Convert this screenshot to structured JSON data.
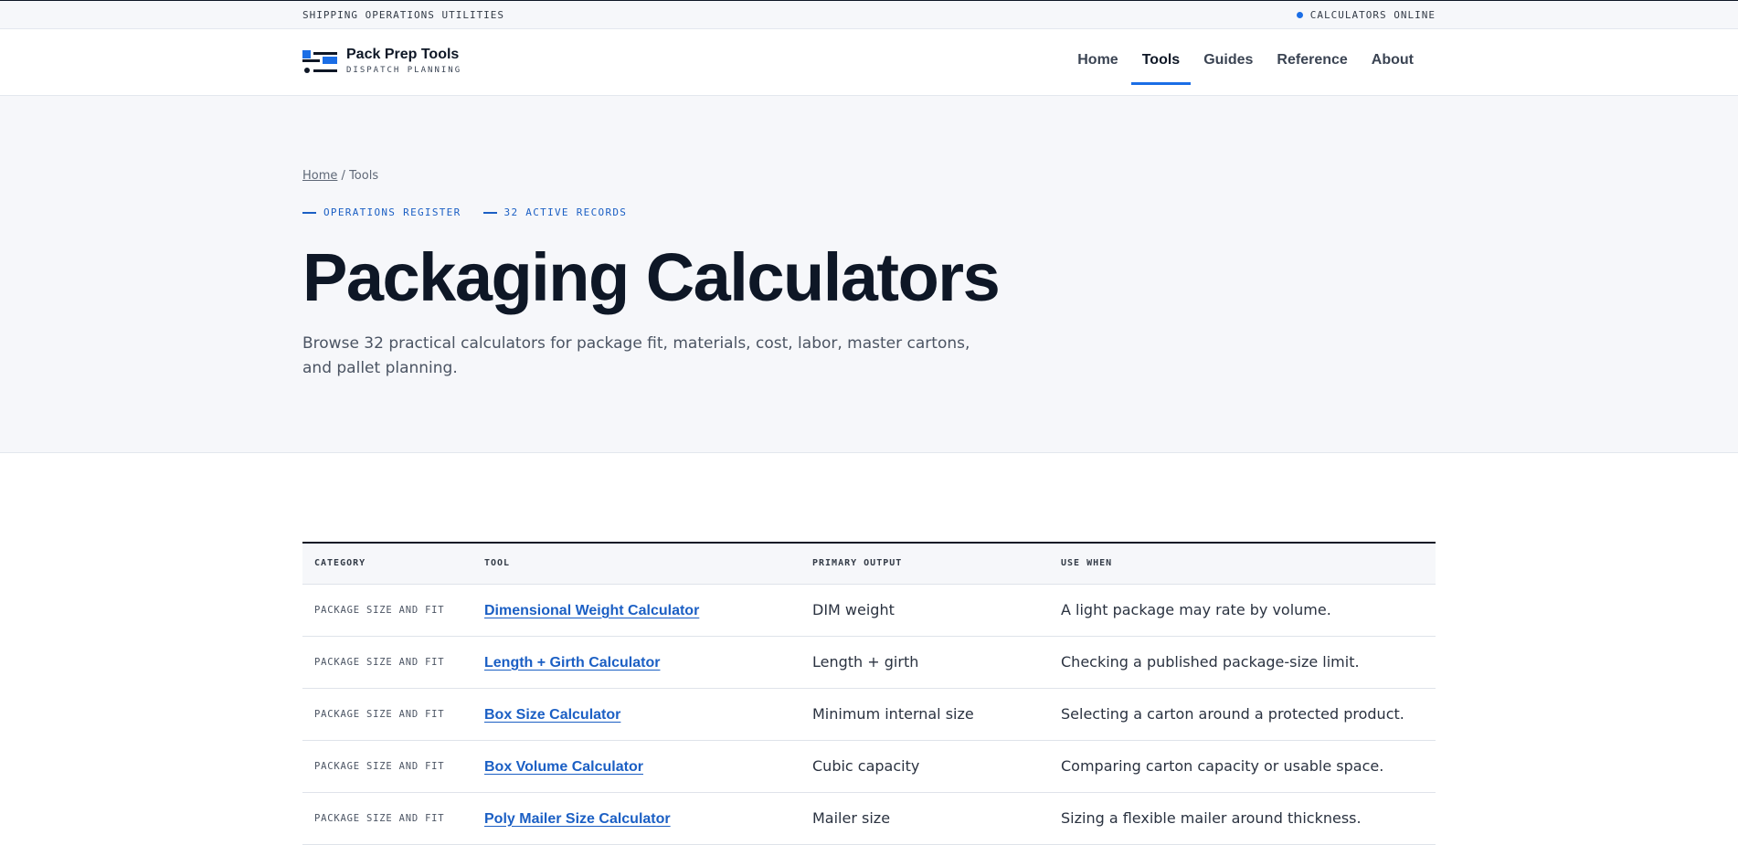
{
  "utility": {
    "left_text": "SHIPPING OPERATIONS UTILITIES",
    "status_text": "CALCULATORS ONLINE"
  },
  "brand": {
    "name": "Pack Prep Tools",
    "tagline": "DISPATCH PLANNING"
  },
  "nav": {
    "items": [
      "Home",
      "Tools",
      "Guides",
      "Reference",
      "About"
    ],
    "active": "Tools"
  },
  "breadcrumb": {
    "home": "Home",
    "separator": "/",
    "current": "Tools"
  },
  "tags": [
    "OPERATIONS REGISTER",
    "32 ACTIVE RECORDS"
  ],
  "hero": {
    "title": "Packaging Calculators",
    "lede": "Browse 32 practical calculators for package fit, materials, cost, labor, master cartons, and pallet planning."
  },
  "table": {
    "headers": [
      "CATEGORY",
      "TOOL",
      "PRIMARY OUTPUT",
      "USE WHEN"
    ],
    "rows": [
      {
        "category": "PACKAGE SIZE AND FIT",
        "tool": "Dimensional Weight Calculator",
        "output": "DIM weight",
        "use_when": "A light package may rate by volume."
      },
      {
        "category": "PACKAGE SIZE AND FIT",
        "tool": "Length + Girth Calculator",
        "output": "Length + girth",
        "use_when": "Checking a published package-size limit."
      },
      {
        "category": "PACKAGE SIZE AND FIT",
        "tool": "Box Size Calculator",
        "output": "Minimum internal size",
        "use_when": "Selecting a carton around a protected product."
      },
      {
        "category": "PACKAGE SIZE AND FIT",
        "tool": "Box Volume Calculator",
        "output": "Cubic capacity",
        "use_when": "Comparing carton capacity or usable space."
      },
      {
        "category": "PACKAGE SIZE AND FIT",
        "tool": "Poly Mailer Size Calculator",
        "output": "Mailer size",
        "use_when": "Sizing a flexible mailer around thickness."
      }
    ]
  },
  "colors": {
    "accent": "#1b6ee6",
    "link": "#1b5fc4",
    "ink": "#0e1726",
    "hero_bg": "#f6f7fa"
  }
}
